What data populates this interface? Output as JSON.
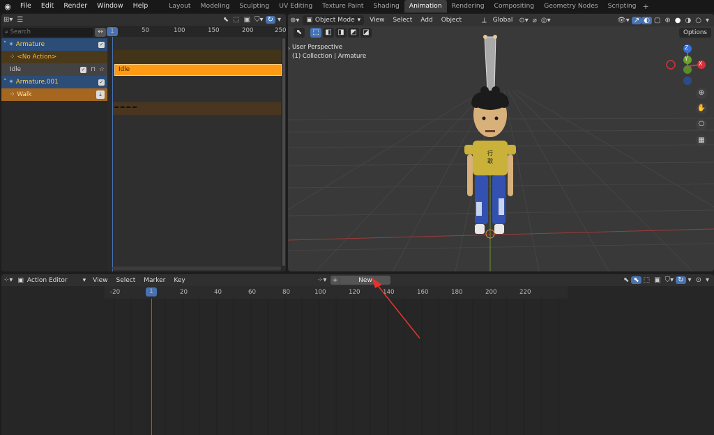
{
  "topbar": {
    "menu": [
      "File",
      "Edit",
      "Render",
      "Window",
      "Help"
    ],
    "workspaces": [
      "Layout",
      "Modeling",
      "Sculpting",
      "UV Editing",
      "Texture Paint",
      "Shading",
      "Animation",
      "Rendering",
      "Compositing",
      "Geometry Nodes",
      "Scripting"
    ],
    "active_workspace": "Animation"
  },
  "nla": {
    "search_placeholder": "Search",
    "ruler": [
      "50",
      "100",
      "150",
      "200",
      "250"
    ],
    "current_frame": "1",
    "tracks": [
      {
        "label": "Armature",
        "type": "obj"
      },
      {
        "label": "<No Action>",
        "type": "noact"
      },
      {
        "label": "Idle",
        "type": "idle"
      },
      {
        "label": "Armature.001",
        "type": "obj"
      },
      {
        "label": "Walk",
        "type": "walk"
      }
    ],
    "strip_idle": "Idle"
  },
  "viewport": {
    "mode": "Object Mode",
    "menus": [
      "View",
      "Select",
      "Add",
      "Object"
    ],
    "orientation": "Global",
    "options": "Options",
    "perspective": "User Perspective",
    "collection": "(1) Collection | Armature",
    "axes": {
      "z": "Z",
      "y": "Y",
      "x": "X"
    },
    "shirt_text": "行 歌"
  },
  "action_editor": {
    "editor_type": "Action Editor",
    "menus": [
      "View",
      "Select",
      "Marker",
      "Key"
    ],
    "new_plus": "+",
    "new_label": "New",
    "current_frame": "1",
    "ruler": [
      "-20",
      "20",
      "40",
      "60",
      "80",
      "100",
      "120",
      "140",
      "160",
      "180",
      "200",
      "220"
    ]
  },
  "colors": {
    "accent": "#4772b3",
    "strip_orange": "#ff9a14",
    "arrow_red": "#e0342c"
  }
}
